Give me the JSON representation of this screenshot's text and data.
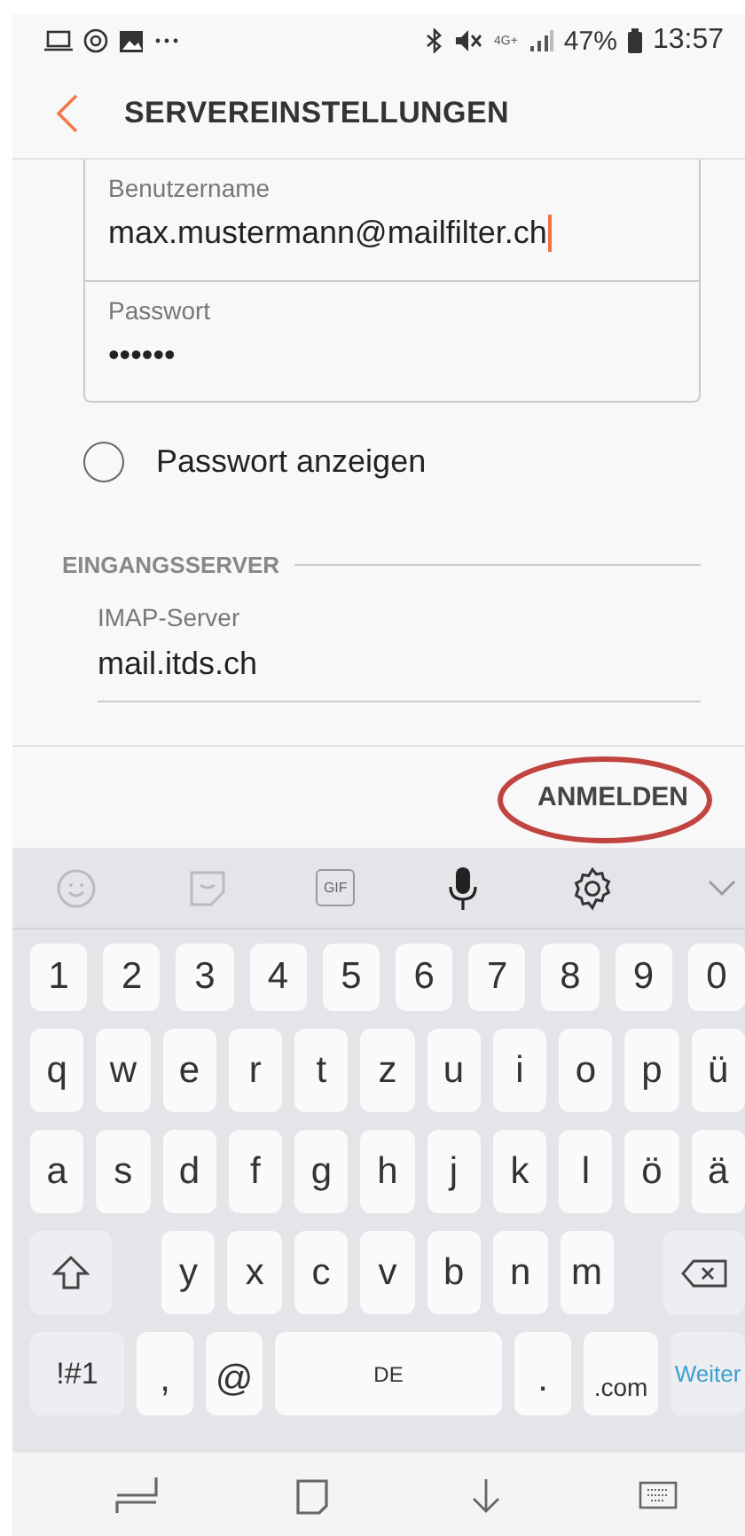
{
  "status_bar": {
    "network": "4G+",
    "battery": "47%",
    "time": "13:57"
  },
  "header": {
    "title": "SERVEREINSTELLUNGEN"
  },
  "account_fields": [
    {
      "label": "Benutzername",
      "value": "max.mustermann@mailfilter.ch",
      "focused": true
    },
    {
      "label": "Passwort",
      "value": "••••••",
      "focused": false
    }
  ],
  "show_password": {
    "label": "Passwort anzeigen",
    "checked": false
  },
  "incoming_server": {
    "heading": "EINGANGSSERVER",
    "field": {
      "label": "IMAP-Server",
      "value": "mail.itds.ch"
    }
  },
  "action": {
    "label": "ANMELDEN",
    "highlighted": true
  },
  "keyboard_toolbar": [
    {
      "kind": "emoji"
    },
    {
      "kind": "sticker"
    },
    {
      "kind": "gif",
      "label": "GIF"
    },
    {
      "kind": "mic"
    },
    {
      "kind": "settings"
    },
    {
      "kind": "collapse"
    }
  ],
  "keyboard": {
    "number_row": [
      {
        "kind": "number",
        "label": "1"
      },
      {
        "kind": "number",
        "label": "2"
      },
      {
        "kind": "number",
        "label": "3"
      },
      {
        "kind": "number",
        "label": "4"
      },
      {
        "kind": "number",
        "label": "5"
      },
      {
        "kind": "number",
        "label": "6"
      },
      {
        "kind": "number",
        "label": "7"
      },
      {
        "kind": "number",
        "label": "8"
      },
      {
        "kind": "number",
        "label": "9"
      },
      {
        "kind": "number",
        "label": "0"
      }
    ],
    "rows": [
      [
        {
          "kind": "letter",
          "label": "q"
        },
        {
          "kind": "letter",
          "label": "w"
        },
        {
          "kind": "letter",
          "label": "e"
        },
        {
          "kind": "letter",
          "label": "r"
        },
        {
          "kind": "letter",
          "label": "t"
        },
        {
          "kind": "letter",
          "label": "z"
        },
        {
          "kind": "letter",
          "label": "u"
        },
        {
          "kind": "letter",
          "label": "i"
        },
        {
          "kind": "letter",
          "label": "o"
        },
        {
          "kind": "letter",
          "label": "p"
        },
        {
          "kind": "letter",
          "label": "ü"
        }
      ],
      [
        {
          "kind": "letter",
          "label": "a"
        },
        {
          "kind": "letter",
          "label": "s"
        },
        {
          "kind": "letter",
          "label": "d"
        },
        {
          "kind": "letter",
          "label": "f"
        },
        {
          "kind": "letter",
          "label": "g"
        },
        {
          "kind": "letter",
          "label": "h"
        },
        {
          "kind": "letter",
          "label": "j"
        },
        {
          "kind": "letter",
          "label": "k"
        },
        {
          "kind": "letter",
          "label": "l"
        },
        {
          "kind": "letter",
          "label": "ö"
        },
        {
          "kind": "letter",
          "label": "ä"
        }
      ],
      [
        {
          "kind": "shift"
        },
        {
          "kind": "gap"
        },
        {
          "kind": "letter",
          "label": "y"
        },
        {
          "kind": "letter",
          "label": "x"
        },
        {
          "kind": "letter",
          "label": "c"
        },
        {
          "kind": "letter",
          "label": "v"
        },
        {
          "kind": "letter",
          "label": "b"
        },
        {
          "kind": "letter",
          "label": "n"
        },
        {
          "kind": "letter",
          "label": "m"
        },
        {
          "kind": "gap"
        },
        {
          "kind": "backspace"
        }
      ]
    ],
    "bottom_row": [
      {
        "kind": "symbols",
        "label": "!#1"
      },
      {
        "kind": "punct",
        "label": ","
      },
      {
        "kind": "punct",
        "label": "@"
      },
      {
        "kind": "space",
        "label": "DE"
      },
      {
        "kind": "punct",
        "label": "."
      },
      {
        "kind": "domain",
        "label": ".com"
      },
      {
        "kind": "enter",
        "label": "Weiter"
      }
    ]
  }
}
